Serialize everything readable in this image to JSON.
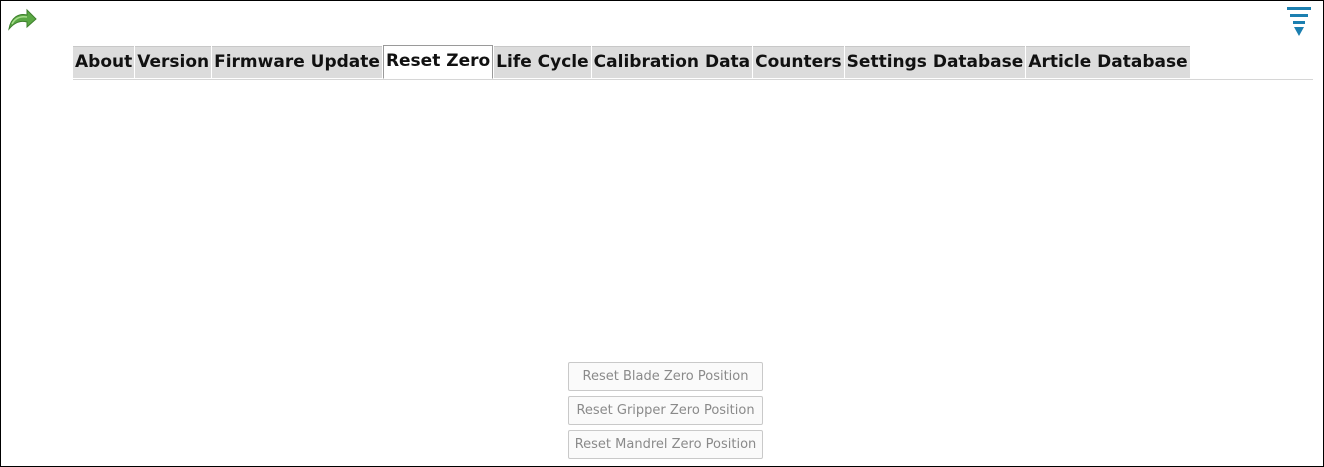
{
  "header": {
    "back_icon": "back-arrow-icon",
    "menu_icon": "filter-menu-icon"
  },
  "tabs": [
    {
      "label": "About",
      "active": false
    },
    {
      "label": "Version",
      "active": false
    },
    {
      "label": "Firmware Update",
      "active": false
    },
    {
      "label": "Reset Zero",
      "active": true
    },
    {
      "label": "Life Cycle",
      "active": false
    },
    {
      "label": "Calibration Data",
      "active": false
    },
    {
      "label": "Counters",
      "active": false
    },
    {
      "label": "Settings Database",
      "active": false
    },
    {
      "label": "Article Database",
      "active": false
    }
  ],
  "actions": {
    "reset_blade": "Reset Blade Zero Position",
    "reset_gripper": "Reset Gripper Zero Position",
    "reset_mandrel": "Reset Mandrel Zero Position"
  },
  "colors": {
    "back_icon": "#4f9a3a",
    "menu_icon": "#1c7fb0",
    "tab_bg": "#dcdcdc",
    "tab_active_bg": "#ffffff",
    "button_text": "#8a8a8a"
  }
}
